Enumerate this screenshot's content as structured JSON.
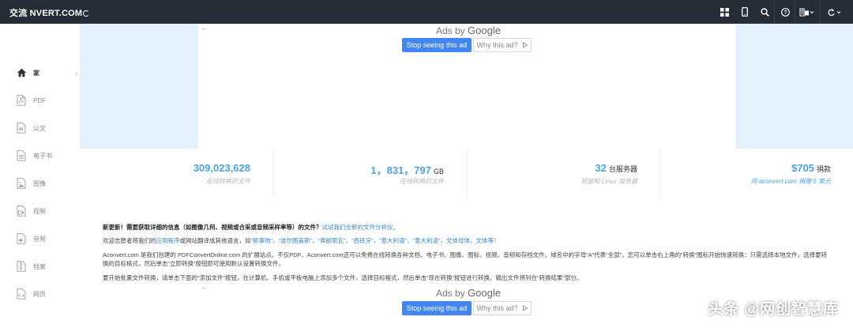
{
  "header": {
    "brand": "交流 NVERT.COM",
    "icons": [
      "grid-icon",
      "mobile-icon",
      "search-icon",
      "help-icon",
      "language-icon",
      "refresh-icon"
    ]
  },
  "sidebar": {
    "items": [
      {
        "label": "家",
        "icon": "home-icon",
        "active": true
      },
      {
        "label": "PDF",
        "icon": "pdf-file-icon"
      },
      {
        "label": "公文",
        "icon": "document-icon"
      },
      {
        "label": "电子书",
        "icon": "ebook-icon"
      },
      {
        "label": "图像",
        "icon": "image-icon"
      },
      {
        "label": "视频",
        "icon": "video-icon"
      },
      {
        "label": "音频",
        "icon": "audio-icon"
      },
      {
        "label": "档案",
        "icon": "archive-icon"
      },
      {
        "label": "网页",
        "icon": "webpage-icon"
      }
    ]
  },
  "ad": {
    "ads_by": "Ads by",
    "google": "Google",
    "stop_label": "Stop seeing this ad",
    "why_label": "Why this ad?",
    "back_arrow": "←"
  },
  "stats": [
    {
      "value": "309,023,628",
      "unit": "",
      "caption": "在线转换的文件"
    },
    {
      "value": "1，831，797",
      "unit": "GB",
      "caption": "在线转换的文件"
    },
    {
      "value": "32",
      "unit": "台服务器",
      "caption": "视窗和 Linux 服务器"
    },
    {
      "value": "$705",
      "unit": "捐款",
      "caption": "向 aconvert.com 捐赠 5 美元"
    }
  ],
  "content": {
    "news_bold": "新更新！需要获取详细的信息（如图像几何、视频或合采或音频采样率等）的文件？",
    "news_link": "试试我们全新的文件分析仪。",
    "welcome_prefix": "欢迎志愿者将我们的",
    "welcome_link1": "应用程序",
    "welcome_mid": "或网站翻译成其他语言，如",
    "welcome_links": "“新事物”，“波尔图盖斯”，“弗朗索瓦”，“西班牙”，“意大利语”，“意大利语”，文体母体，文体等！",
    "intro": "Aconvert.com 是我们创建的 PDFConvertOnline.com 的扩展站点。不仅PDF、Aconvert.com还可以免费在线转换各种文档、电子书、图像、图标、视频、音频和存档文件。域名中的字母“A”代表“全部”。您可以单击右上角的“转换”图标开始快速转换：只需选择本地文件，选择要转换的目标格式，然后单击“立即转换”按钮即可使用默认设置转换文件。",
    "batch": "要开始批量文件转换，请单击下面的“添加文件”按钮，在计算机、手机或平板电脑上添加多个文件，选择目标格式，然后单击“现在转换”按钮进行转换。输出文件将列在“转换结果”部分。"
  },
  "watermark": "头条 @网创智慧库"
}
